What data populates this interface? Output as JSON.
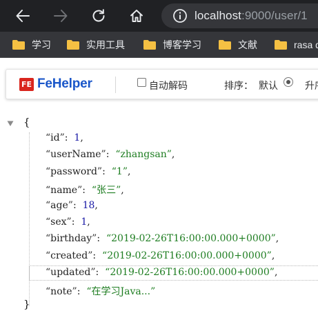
{
  "browser": {
    "url_host": "localhost",
    "url_rest": ":9000/user/1",
    "bookmarks": [
      "学习",
      "实用工具",
      "博客学习",
      "文献",
      "rasa d"
    ]
  },
  "icons": {
    "back": "arrow-left-icon",
    "forward": "arrow-right-icon",
    "reload": "reload-icon",
    "home": "home-icon",
    "site_info": "info-icon",
    "bookmark_folder": "folder-icon",
    "fehelper_logo": "fehelper-logo-icon",
    "collapse": "triangle-down-icon"
  },
  "colors": {
    "chrome_dark": "#202124",
    "bookmark_bar": "#35363a",
    "folder": "#f5c043",
    "fehelper_brand": "#1a56c9",
    "json_number": "#1a1aa6",
    "json_string": "#1e7d21"
  },
  "fehelper": {
    "logo_text": "FE",
    "title": "FeHelper",
    "auto_decode_label": "自动解码",
    "auto_decode_checked": false,
    "sort_label": "排序：",
    "sort_default_label": "默认",
    "sort_asc_label": "升序",
    "sort_selected": "默认"
  },
  "json": {
    "open_brace": "{",
    "close_brace": "}",
    "fields": [
      {
        "key": "id",
        "type": "number",
        "value": "1",
        "comma": true
      },
      {
        "key": "userName",
        "type": "string",
        "value": "zhangsan",
        "comma": true
      },
      {
        "key": "password",
        "type": "string",
        "value": "1",
        "comma": true
      },
      {
        "key": "name",
        "type": "string",
        "value": "张三",
        "comma": true
      },
      {
        "key": "age",
        "type": "number",
        "value": "18",
        "comma": true
      },
      {
        "key": "sex",
        "type": "number",
        "value": "1",
        "comma": true
      },
      {
        "key": "birthday",
        "type": "string",
        "value": "2019-02-26T16:00:00.000+0000",
        "comma": true
      },
      {
        "key": "created",
        "type": "string",
        "value": "2019-02-26T16:00:00.000+0000",
        "comma": true
      },
      {
        "key": "updated",
        "type": "string",
        "value": "2019-02-26T16:00:00.000+0000",
        "comma": true,
        "highlighted": true
      },
      {
        "key": "note",
        "type": "string",
        "value": "在学习Java...",
        "comma": false
      }
    ]
  }
}
